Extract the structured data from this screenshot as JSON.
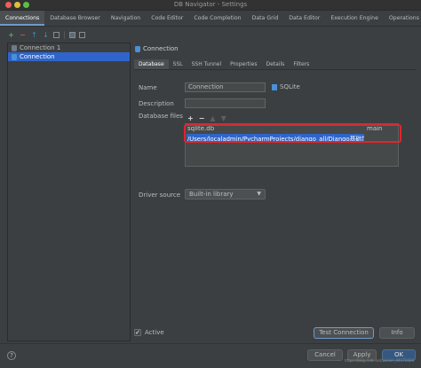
{
  "window": {
    "title": "DB Navigator - Settings"
  },
  "tabs": [
    {
      "label": "Connections",
      "active": true
    },
    {
      "label": "Database Browser",
      "active": false
    },
    {
      "label": "Navigation",
      "active": false
    },
    {
      "label": "Code Editor",
      "active": false
    },
    {
      "label": "Code Completion",
      "active": false
    },
    {
      "label": "Data Grid",
      "active": false
    },
    {
      "label": "Data Editor",
      "active": false
    },
    {
      "label": "Execution Engine",
      "active": false
    },
    {
      "label": "Operations",
      "active": false
    }
  ],
  "toolbar": {
    "add_glyph": "+",
    "remove_glyph": "−",
    "move_up_glyph": "↑",
    "move_down_glyph": "↓"
  },
  "tree": {
    "items": [
      {
        "label": "Connection 1",
        "selected": false
      },
      {
        "label": "Connection",
        "selected": true
      }
    ]
  },
  "connection": {
    "header_label": "Connection",
    "subtabs": [
      {
        "label": "Database",
        "active": true
      },
      {
        "label": "SSL",
        "active": false
      },
      {
        "label": "SSH Tunnel",
        "active": false
      },
      {
        "label": "Properties",
        "active": false
      },
      {
        "label": "Details",
        "active": false
      },
      {
        "label": "Filters",
        "active": false
      }
    ],
    "name_label": "Name",
    "name_value": "Connection",
    "db_type_label": "SQLite",
    "description_label": "Description",
    "description_value": "",
    "files_label": "Database files",
    "files_add_glyph": "+",
    "files_remove_glyph": "−",
    "files_up_glyph": "▲",
    "files_down_glyph": "▼",
    "files_header": {
      "file": "sqlite.db",
      "schema": "main"
    },
    "files_row": {
      "path": "/Users/localadmin/PycharmProjects/django_all/Django基础加"
    },
    "driver_label": "Driver source",
    "driver_value": "Built-in library",
    "active_label": "Active",
    "active_checked_glyph": "✓",
    "test_button": "Test Connection",
    "info_button": "Info"
  },
  "footer": {
    "help_glyph": "?",
    "cancel": "Cancel",
    "apply": "Apply",
    "ok": "OK",
    "watermark": "https://blog.csdn.net/weixin_44171020"
  },
  "colors": {
    "background": "#3c3f41",
    "selection": "#2f65ca",
    "highlight_box": "#e0252b",
    "primary_button": "#365880"
  }
}
